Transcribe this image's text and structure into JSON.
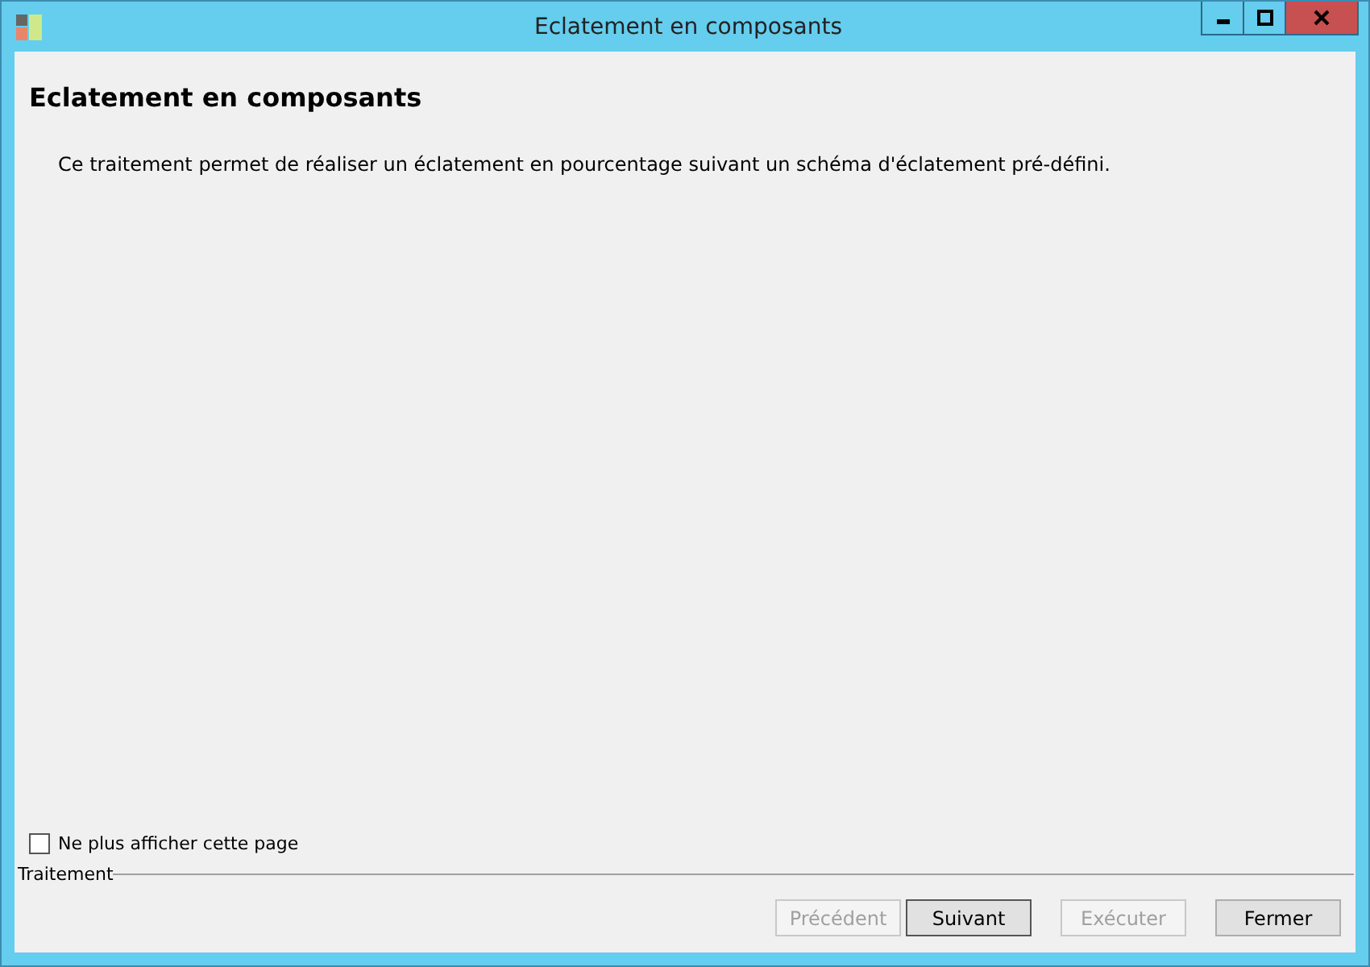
{
  "window": {
    "title": "Eclatement en composants"
  },
  "heading": "Eclatement en composants",
  "description": "Ce traitement permet de réaliser un éclatement en pourcentage suivant un schéma d'éclatement pré-défini.",
  "dont_show_again": {
    "label": "Ne plus afficher cette page",
    "checked": false
  },
  "group_label": "Traitement",
  "buttons": [
    {
      "label": "Précédent",
      "disabled": true,
      "default": false
    },
    {
      "label": "Suivant",
      "disabled": false,
      "default": true
    },
    {
      "label": "Exécuter",
      "disabled": true,
      "default": false
    },
    {
      "label": "Fermer",
      "disabled": false,
      "default": false
    }
  ]
}
